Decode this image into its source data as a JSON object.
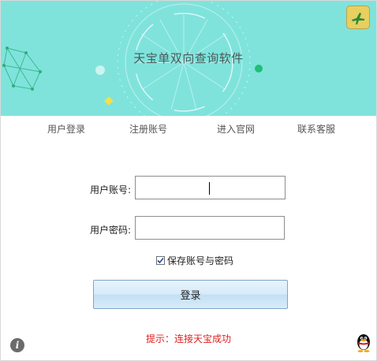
{
  "header": {
    "app_title": "天宝单双向查询软件",
    "corner_button_icon": "plane-icon",
    "background_color": "#7fe3dc"
  },
  "nav": {
    "items": [
      {
        "label": "用户登录"
      },
      {
        "label": "注册账号"
      },
      {
        "label": "进入官网"
      },
      {
        "label": "联系客服"
      }
    ]
  },
  "form": {
    "account_label": "用户账号:",
    "account_value": "",
    "password_label": "用户密码:",
    "password_value": "",
    "remember_label": "保存账号与密码",
    "remember_checked": true,
    "login_label": "登录"
  },
  "status": {
    "message": "提示：连接天宝成功",
    "color": "#e02020"
  },
  "footer": {
    "info_icon": "info-icon",
    "qq_icon": "qq-penguin-icon"
  }
}
